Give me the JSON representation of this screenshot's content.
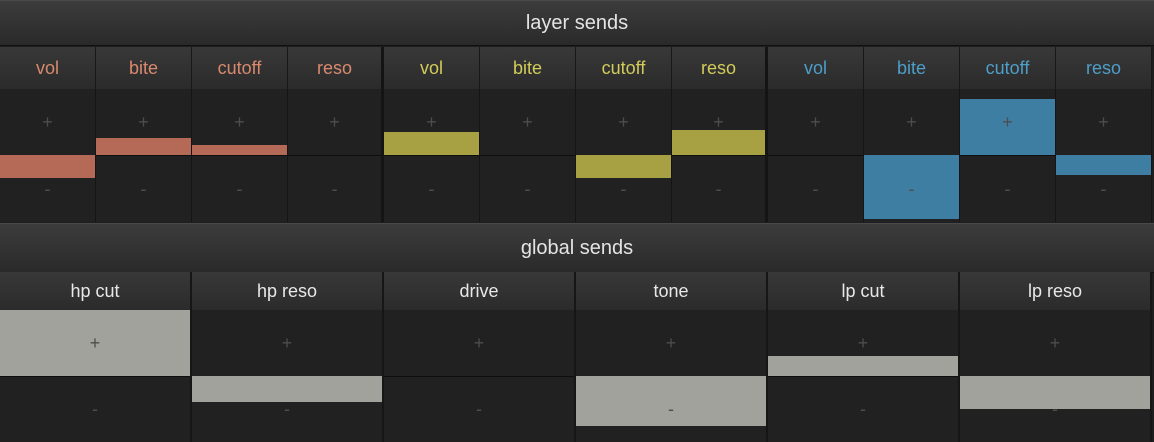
{
  "layer_sends": {
    "title": "layer sends",
    "groups": [
      {
        "color": "#d98a6e",
        "bar_color": "#b46a56",
        "params": [
          {
            "label": "vol",
            "value": -0.35
          },
          {
            "label": "bite",
            "value": 0.25
          },
          {
            "label": "cutoff",
            "value": 0.15
          },
          {
            "label": "reso",
            "value": 0.0
          }
        ]
      },
      {
        "color": "#d2cc5a",
        "bar_color": "#a8a143",
        "params": [
          {
            "label": "vol",
            "value": 0.35
          },
          {
            "label": "bite",
            "value": 0.0
          },
          {
            "label": "cutoff",
            "value": -0.35
          },
          {
            "label": "reso",
            "value": 0.38
          }
        ]
      },
      {
        "color": "#4d9ec9",
        "bar_color": "#3f7ea3",
        "params": [
          {
            "label": "vol",
            "value": 0.0
          },
          {
            "label": "bite",
            "value": -0.95
          },
          {
            "label": "cutoff",
            "value": 0.85
          },
          {
            "label": "reso",
            "value": -0.3
          }
        ]
      }
    ],
    "plus_symbol": "+",
    "minus_symbol": "-"
  },
  "global_sends": {
    "title": "global sends",
    "bar_color": "#a2a29c",
    "params": [
      {
        "label": "hp cut",
        "value": 1.0
      },
      {
        "label": "hp reso",
        "value": -0.4
      },
      {
        "label": "drive",
        "value": 0.0
      },
      {
        "label": "tone",
        "value": -0.75
      },
      {
        "label": "lp cut",
        "value": 0.3
      },
      {
        "label": "lp reso",
        "value": -0.5
      }
    ],
    "plus_symbol": "+",
    "minus_symbol": "-"
  }
}
